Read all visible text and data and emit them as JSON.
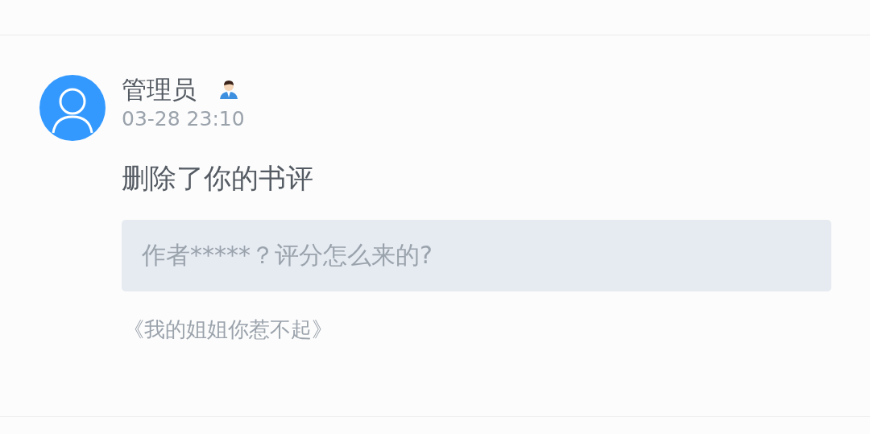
{
  "notice": {
    "author": "管理员",
    "time": "03-28 23:10",
    "message": "删除了你的书评",
    "quote": "作者*****？评分怎么来的?",
    "book": "《我的姐姐你惹不起》"
  }
}
